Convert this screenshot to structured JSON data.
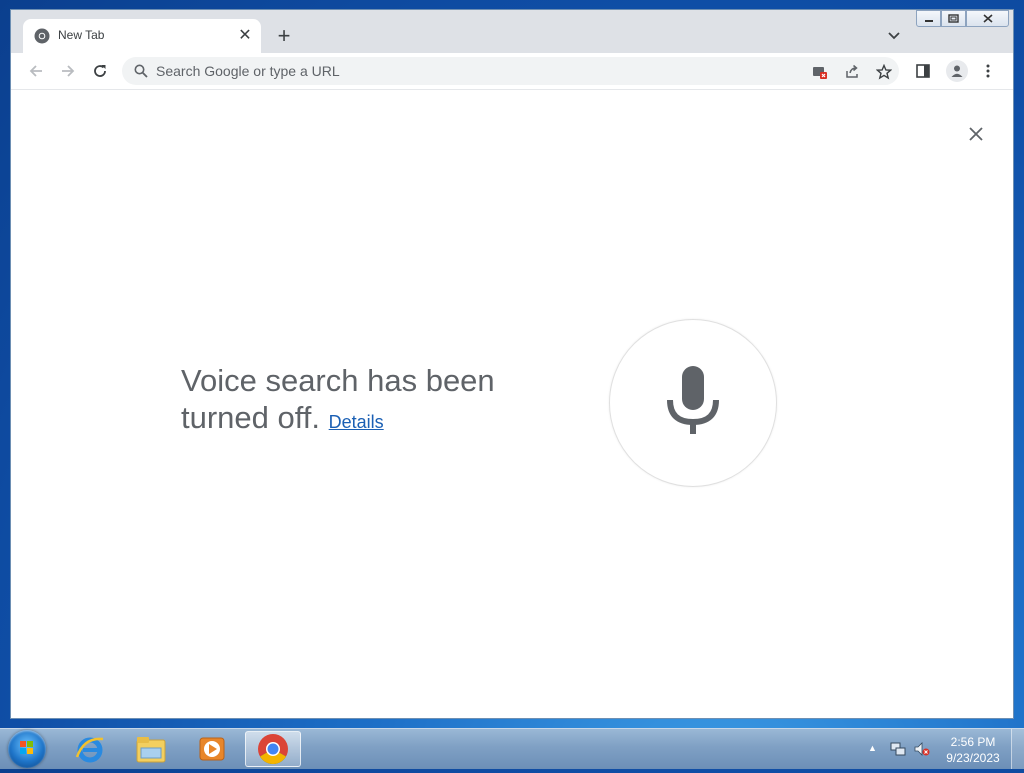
{
  "browser": {
    "tab": {
      "title": "New Tab"
    },
    "omnibox": {
      "placeholder": "Search Google or type a URL"
    }
  },
  "voice_search": {
    "message": "Voice search has been turned off.",
    "details_link": "Details"
  },
  "taskbar": {
    "clock_time": "2:56 PM",
    "clock_date": "9/23/2023"
  },
  "icons": [
    "chrome-icon",
    "close-icon",
    "plus-icon",
    "chevron-down-icon",
    "back-arrow-icon",
    "forward-arrow-icon",
    "reload-icon",
    "search-icon",
    "extension-blocked-icon",
    "share-icon",
    "star-icon",
    "side-panel-icon",
    "profile-icon",
    "menu-icon",
    "microphone-icon",
    "start-orb",
    "internet-explorer-icon",
    "file-explorer-icon",
    "media-player-icon",
    "network-icon",
    "volume-muted-icon"
  ],
  "colors": {
    "accent_link": "#1a5fb4",
    "text_gray": "#5f6368",
    "tabstrip": "#dee1e6"
  }
}
